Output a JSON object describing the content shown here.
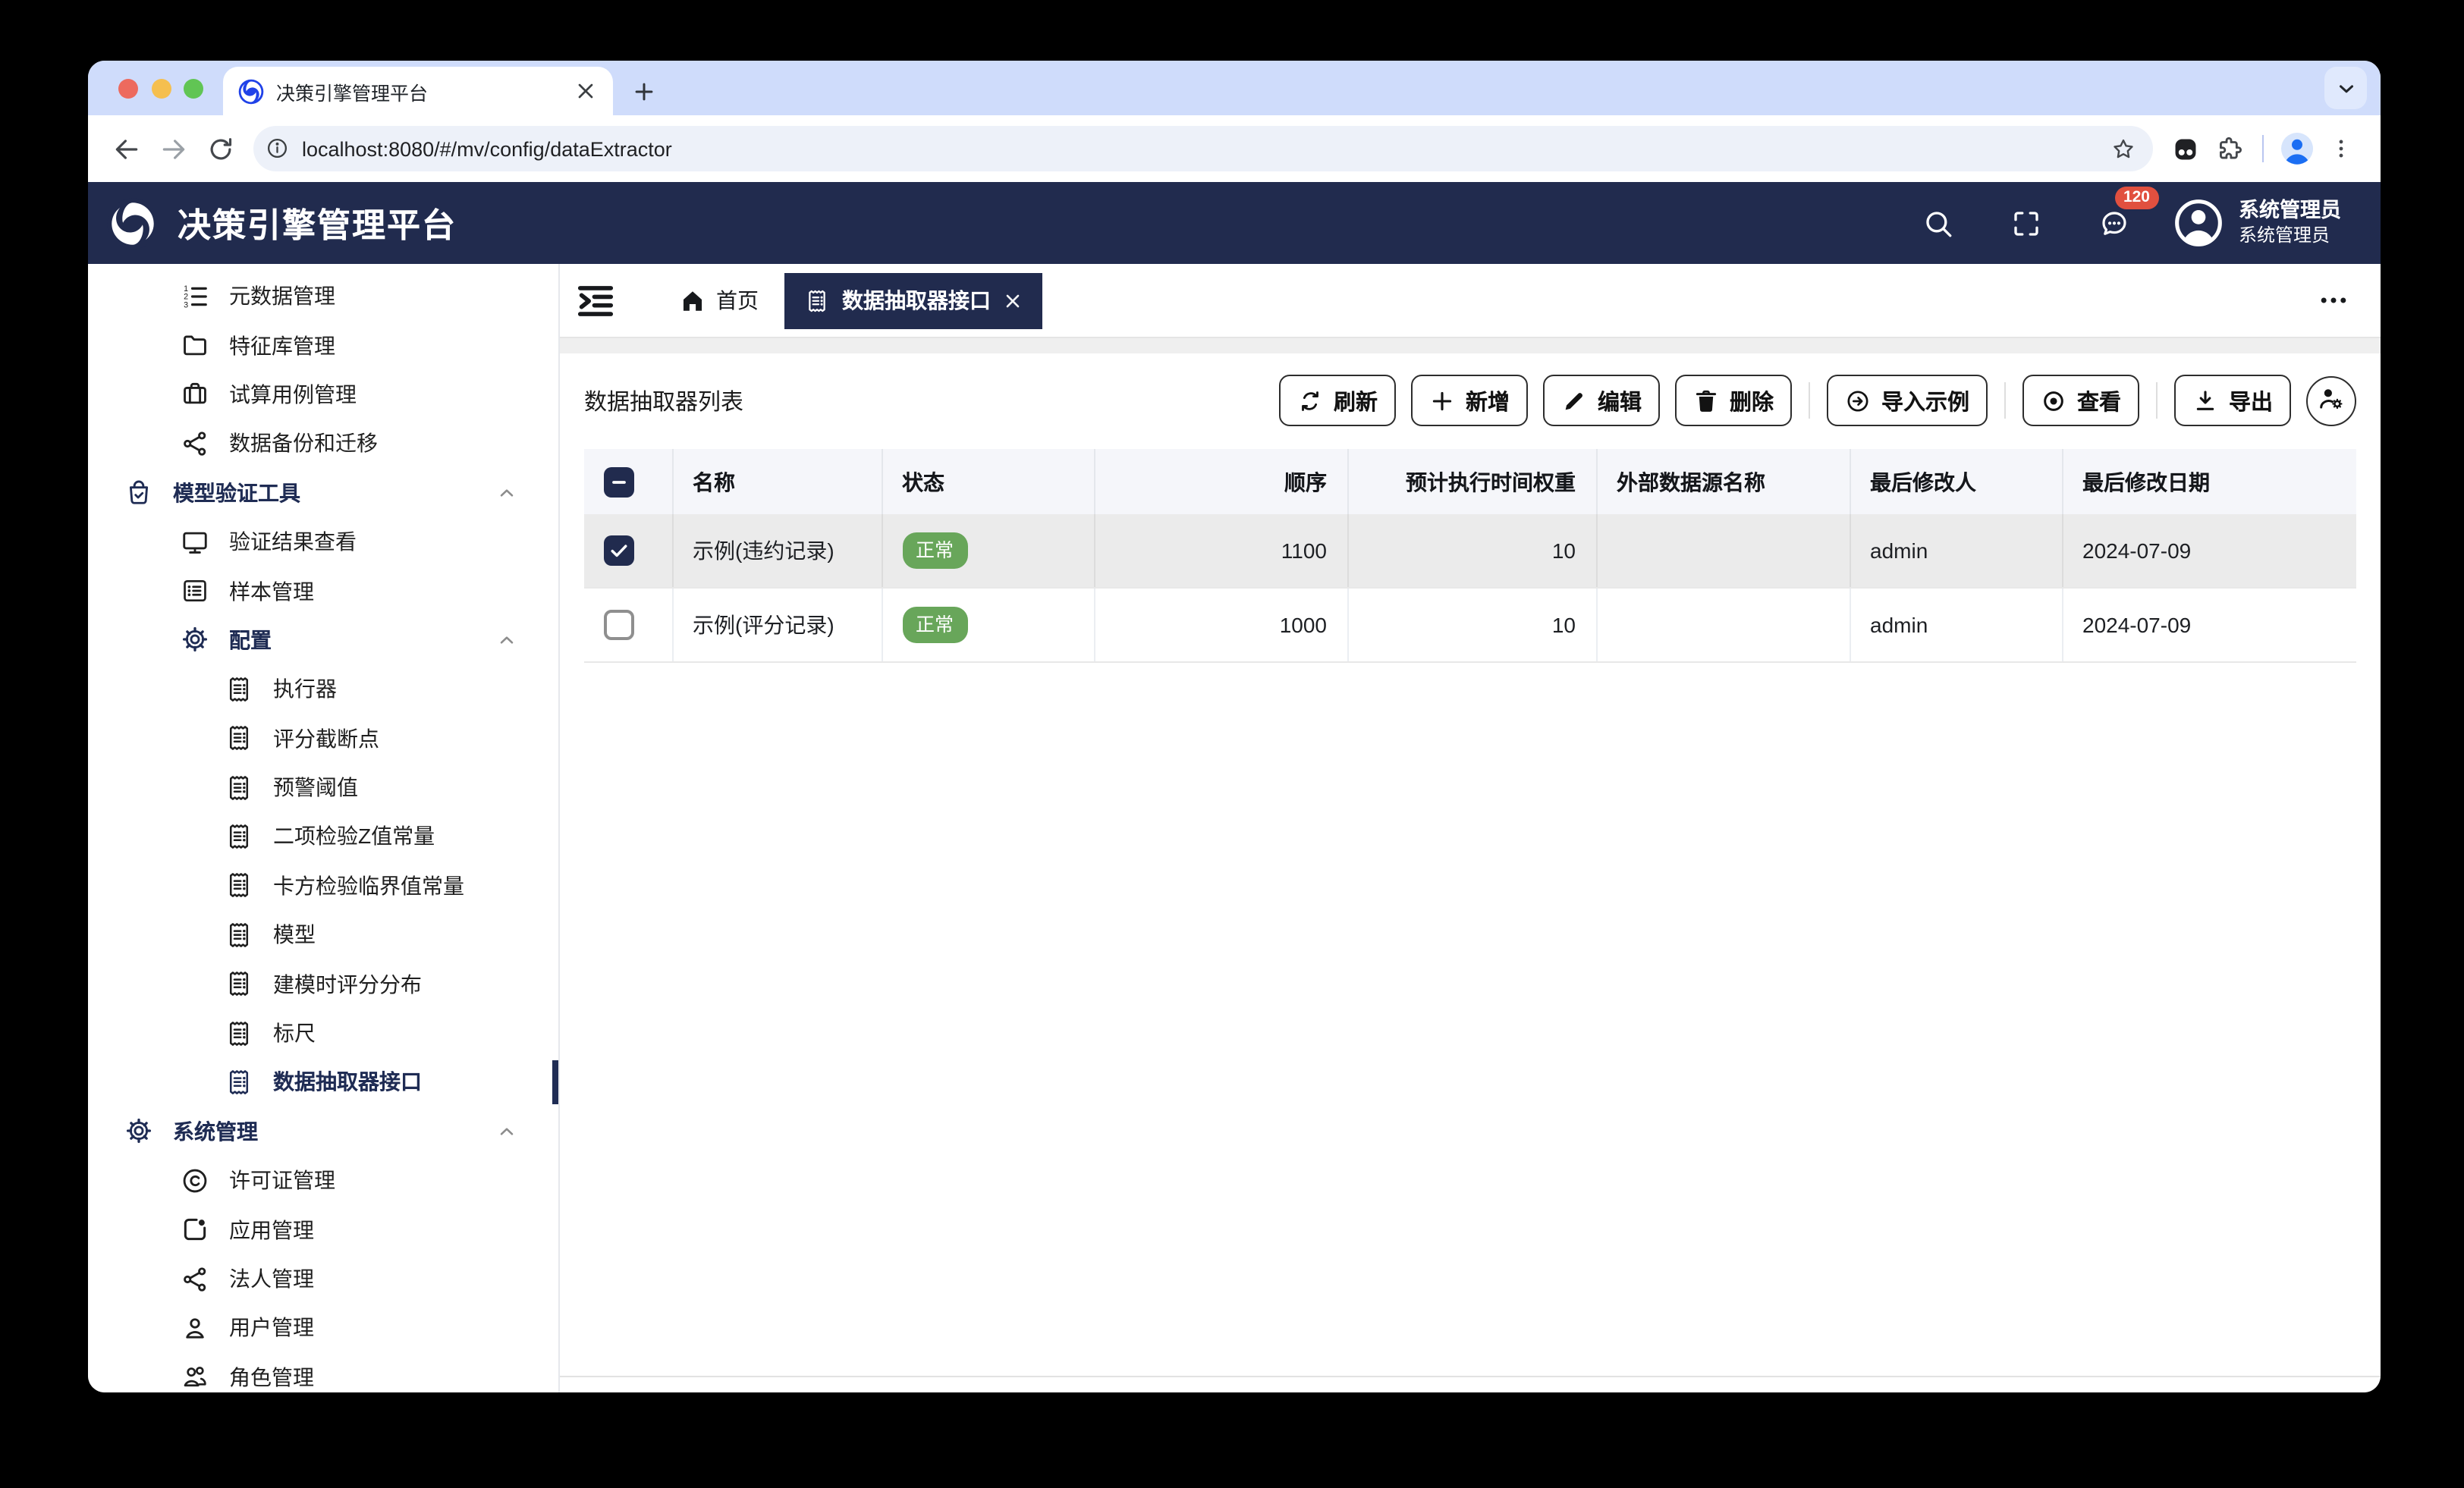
{
  "colors": {
    "navy": "#212b4e",
    "green": "#68a65a",
    "red": "#e1503f",
    "tabstrip": "#cfdcfb",
    "chrome_blue": "#1b6ef3"
  },
  "browser": {
    "tab_title": "决策引擎管理平台",
    "url": "localhost:8080/#/mv/config/dataExtractor"
  },
  "header": {
    "app_title": "决策引擎管理平台",
    "notification_count": "120",
    "user_name": "系统管理员",
    "user_role": "系统管理员"
  },
  "sidebar": {
    "items": [
      {
        "id": "metadata-mgmt",
        "label": "元数据管理",
        "icon": "list-ordered",
        "level": 2
      },
      {
        "id": "feature-lib-mgmt",
        "label": "特征库管理",
        "icon": "folder",
        "level": 2
      },
      {
        "id": "trial-case-mgmt",
        "label": "试算用例管理",
        "icon": "briefcase",
        "level": 2
      },
      {
        "id": "data-backup-migration",
        "label": "数据备份和迁移",
        "icon": "share",
        "level": 2
      },
      {
        "id": "model-validation-tools",
        "label": "模型验证工具",
        "icon": "bag-check",
        "level": 1,
        "section": true,
        "expanded": true
      },
      {
        "id": "validation-result-view",
        "label": "验证结果查看",
        "icon": "monitor",
        "level": 2
      },
      {
        "id": "sample-mgmt",
        "label": "样本管理",
        "icon": "list-alt",
        "level": 2
      },
      {
        "id": "config",
        "label": "配置",
        "icon": "gear",
        "level": 2,
        "section": true,
        "expanded": true
      },
      {
        "id": "executor",
        "label": "执行器",
        "icon": "receipt",
        "level": 3
      },
      {
        "id": "score-cutoff",
        "label": "评分截断点",
        "icon": "receipt",
        "level": 3
      },
      {
        "id": "warning-threshold",
        "label": "预警阈值",
        "icon": "receipt",
        "level": 3
      },
      {
        "id": "binomial-z-constant",
        "label": "二项检验Z值常量",
        "icon": "receipt",
        "level": 3
      },
      {
        "id": "chi-square-critical",
        "label": "卡方检验临界值常量",
        "icon": "receipt",
        "level": 3
      },
      {
        "id": "model",
        "label": "模型",
        "icon": "receipt",
        "level": 3
      },
      {
        "id": "modeling-score-distribution",
        "label": "建模时评分分布",
        "icon": "receipt",
        "level": 3
      },
      {
        "id": "ruler",
        "label": "标尺",
        "icon": "receipt",
        "level": 3
      },
      {
        "id": "data-extractor-api",
        "label": "数据抽取器接口",
        "icon": "receipt",
        "level": 3,
        "selected": true
      },
      {
        "id": "system-mgmt",
        "label": "系统管理",
        "icon": "gear",
        "level": 1,
        "section": true,
        "expanded": true
      },
      {
        "id": "license-mgmt",
        "label": "许可证管理",
        "icon": "copyright",
        "level": 2
      },
      {
        "id": "app-mgmt",
        "label": "应用管理",
        "icon": "app-square",
        "level": 2
      },
      {
        "id": "legal-entity-mgmt",
        "label": "法人管理",
        "icon": "share",
        "level": 2
      },
      {
        "id": "user-mgmt",
        "label": "用户管理",
        "icon": "person",
        "level": 2
      },
      {
        "id": "role-mgmt",
        "label": "角色管理",
        "icon": "people",
        "level": 2
      }
    ]
  },
  "tabs": {
    "home_label": "首页",
    "active_label": "数据抽取器接口"
  },
  "content": {
    "list_title": "数据抽取器列表",
    "toolbar": [
      {
        "id": "refresh",
        "label": "刷新",
        "icon": "refresh"
      },
      {
        "id": "add",
        "label": "新增",
        "icon": "plus"
      },
      {
        "id": "edit",
        "label": "编辑",
        "icon": "pencil"
      },
      {
        "id": "delete",
        "label": "删除",
        "icon": "trash"
      },
      {
        "id": "import-sample",
        "label": "导入示例",
        "icon": "arrow-right-circle",
        "divider_before": true
      },
      {
        "id": "view",
        "label": "查看",
        "icon": "view-dot",
        "divider_before": true
      },
      {
        "id": "export",
        "label": "导出",
        "icon": "download",
        "divider_before": true
      },
      {
        "id": "user-config",
        "label": "",
        "icon": "person-gear",
        "circle": true
      }
    ],
    "table": {
      "columns": [
        {
          "label": "名称",
          "align": "left"
        },
        {
          "label": "状态",
          "align": "left"
        },
        {
          "label": "顺序",
          "align": "right"
        },
        {
          "label": "预计执行时间权重",
          "align": "right"
        },
        {
          "label": "外部数据源名称",
          "align": "left"
        },
        {
          "label": "最后修改人",
          "align": "left"
        },
        {
          "label": "最后修改日期",
          "align": "left"
        }
      ],
      "header_checkbox_state": "indeterminate",
      "rows": [
        {
          "checked": true,
          "selected": true,
          "name": "示例(违约记录)",
          "status": "正常",
          "order": "1100",
          "weight": "10",
          "ext_source": "",
          "modifier": "admin",
          "date": "2024-07-09"
        },
        {
          "checked": false,
          "selected": false,
          "name": "示例(评分记录)",
          "status": "正常",
          "order": "1000",
          "weight": "10",
          "ext_source": "",
          "modifier": "admin",
          "date": "2024-07-09"
        }
      ]
    }
  }
}
